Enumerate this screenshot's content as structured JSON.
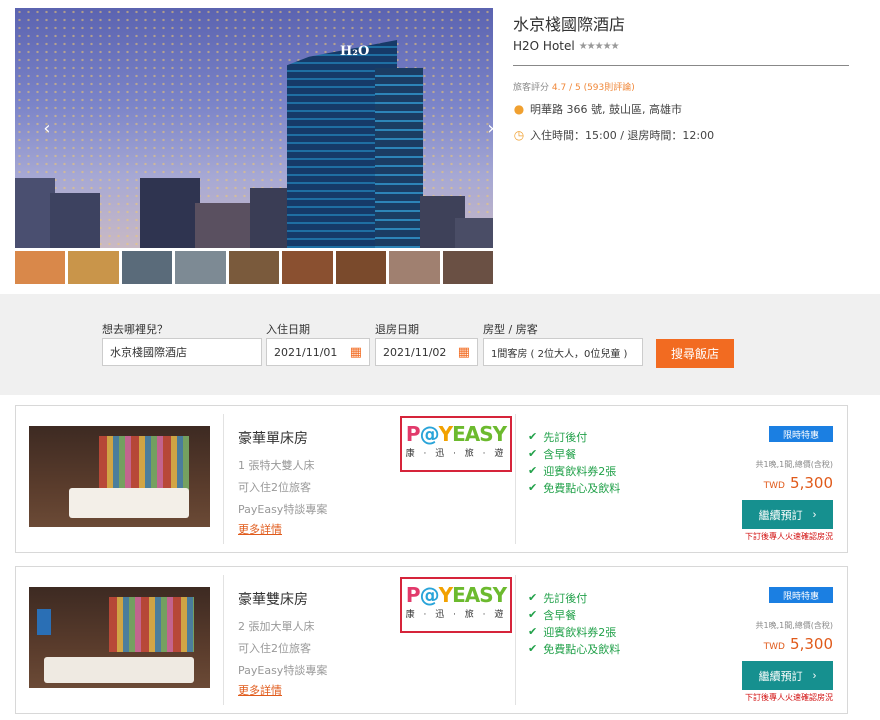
{
  "hotel": {
    "name": "水京棧國際酒店",
    "name_en": "H2O Hotel",
    "stars": "★★★★★",
    "rating_prefix": "旅客評分",
    "rating_score": "4.7 / 5",
    "rating_count": "(593則評論)",
    "address": "明華路 366 號, 鼓山區, 高雄市",
    "checkin": "入住時間：15:00 / 退房時間：12:00",
    "photo_logo": "H₂O"
  },
  "gallery": {
    "prev_icon": "‹",
    "next_icon": "›",
    "thumb_colors": [
      "#d9884a",
      "#c9954a",
      "#5a6b7a",
      "#7d8a94",
      "#7a5a3c",
      "#8a5030",
      "#7a4a2c",
      "#a08070",
      "#6a5044"
    ]
  },
  "search": {
    "destination_label": "想去哪裡兒？",
    "destination_value": "水京棧國際酒店",
    "checkin_label": "入住日期",
    "checkin_value": "2021/11/01",
    "checkout_label": "退房日期",
    "checkout_value": "2021/11/02",
    "rooms_label": "房型 / 房客",
    "rooms_value": "1間客房 ( 2位大人，0位兒童 )",
    "button": "搜尋飯店"
  },
  "rooms": [
    {
      "name": "豪華單床房",
      "bed": "1 張特大雙人床",
      "guests": "可入住2位旅客",
      "plan": "PayEasy特談專案",
      "more": "更多詳情",
      "badge": "限時特惠",
      "perks": [
        "先訂後付",
        "含早餐",
        "迎賓飲料券2張",
        "免費點心及飲料"
      ],
      "price_note": "共1晚,1間,總價(含稅)",
      "currency": "TWD",
      "price": "5,300",
      "book": "繼續預訂",
      "book_note": "下訂後專人火速確認房況"
    },
    {
      "name": "豪華雙床房",
      "bed": "2 張加大單人床",
      "guests": "可入住2位旅客",
      "plan": "PayEasy特談專案",
      "more": "更多詳情",
      "badge": "限時特惠",
      "perks": [
        "先訂後付",
        "含早餐",
        "迎賓飲料券2張",
        "免費點心及飲料"
      ],
      "price_note": "共1晚,1間,總價(含稅)",
      "currency": "TWD",
      "price": "5,300",
      "book": "繼續預訂",
      "book_note": "下訂後專人火速確認房況"
    }
  ],
  "payeasy": {
    "l1": "P",
    "l2": "@",
    "l3": "Y",
    "l4": "EASY",
    "sub": "康 · 迅 · 旅 · 遊"
  }
}
